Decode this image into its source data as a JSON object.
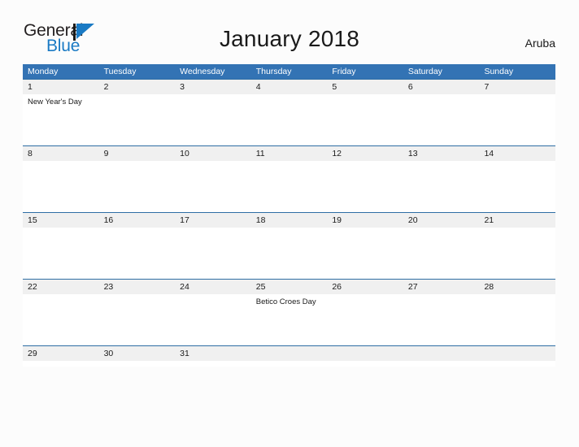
{
  "brand": {
    "name_part1": "General",
    "name_part2": "Blue",
    "mark": "triangle-logo",
    "accent_color": "#1a7ac4",
    "header_color": "#3373b4"
  },
  "header": {
    "title": "January 2018",
    "country": "Aruba"
  },
  "calendar": {
    "weekdays": [
      "Monday",
      "Tuesday",
      "Wednesday",
      "Thursday",
      "Friday",
      "Saturday",
      "Sunday"
    ],
    "weeks": [
      {
        "days": [
          {
            "date": "1",
            "event": "New Year's Day"
          },
          {
            "date": "2",
            "event": ""
          },
          {
            "date": "3",
            "event": ""
          },
          {
            "date": "4",
            "event": ""
          },
          {
            "date": "5",
            "event": ""
          },
          {
            "date": "6",
            "event": ""
          },
          {
            "date": "7",
            "event": ""
          }
        ]
      },
      {
        "days": [
          {
            "date": "8",
            "event": ""
          },
          {
            "date": "9",
            "event": ""
          },
          {
            "date": "10",
            "event": ""
          },
          {
            "date": "11",
            "event": ""
          },
          {
            "date": "12",
            "event": ""
          },
          {
            "date": "13",
            "event": ""
          },
          {
            "date": "14",
            "event": ""
          }
        ]
      },
      {
        "days": [
          {
            "date": "15",
            "event": ""
          },
          {
            "date": "16",
            "event": ""
          },
          {
            "date": "17",
            "event": ""
          },
          {
            "date": "18",
            "event": ""
          },
          {
            "date": "19",
            "event": ""
          },
          {
            "date": "20",
            "event": ""
          },
          {
            "date": "21",
            "event": ""
          }
        ]
      },
      {
        "days": [
          {
            "date": "22",
            "event": ""
          },
          {
            "date": "23",
            "event": ""
          },
          {
            "date": "24",
            "event": ""
          },
          {
            "date": "25",
            "event": "Betico Croes Day"
          },
          {
            "date": "26",
            "event": ""
          },
          {
            "date": "27",
            "event": ""
          },
          {
            "date": "28",
            "event": ""
          }
        ]
      },
      {
        "days": [
          {
            "date": "29",
            "event": ""
          },
          {
            "date": "30",
            "event": ""
          },
          {
            "date": "31",
            "event": ""
          },
          {
            "date": "",
            "event": ""
          },
          {
            "date": "",
            "event": ""
          },
          {
            "date": "",
            "event": ""
          },
          {
            "date": "",
            "event": ""
          }
        ]
      }
    ]
  }
}
